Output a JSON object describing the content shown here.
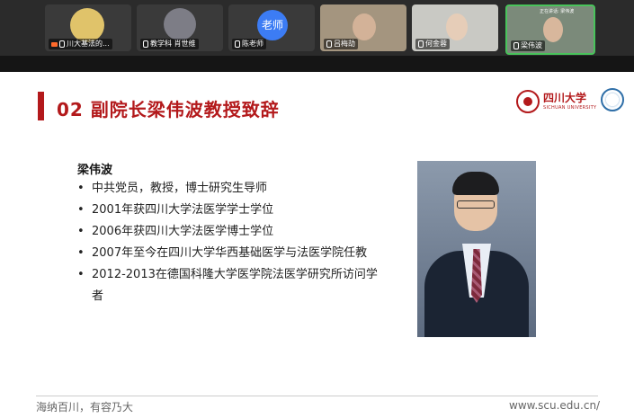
{
  "participants": [
    {
      "name": "川大基法的..."
    },
    {
      "name": "教学科 肖世维"
    },
    {
      "name": "陈老师",
      "avatar_text": "老师"
    },
    {
      "name": "吕梅劼"
    },
    {
      "name": "何金蓉"
    },
    {
      "name": "梁伟波",
      "speaking_label": "正在讲话: 梁伟波"
    }
  ],
  "slide": {
    "title": "02 副院长梁伟波教授致辞",
    "logo_cn": "四川大学",
    "logo_en": "SICHUAN UNIVERSITY",
    "person_name": "梁伟波",
    "bio": [
      "中共党员，教授，博士研究生导师",
      "2001年获四川大学法医学学士学位",
      "2006年获四川大学法医学博士学位",
      "2007年至今在四川大学华西基础医学与法医学院任教",
      "2012-2013在德国科隆大学医学院法医学研究所访问学者"
    ],
    "footer_left": "海纳百川，有容乃大",
    "footer_right": "www.scu.edu.cn/"
  },
  "colors": {
    "accent_red": "#b3191b",
    "speaking_green": "#49c35b",
    "teacher_blue": "#3c7cf4"
  }
}
